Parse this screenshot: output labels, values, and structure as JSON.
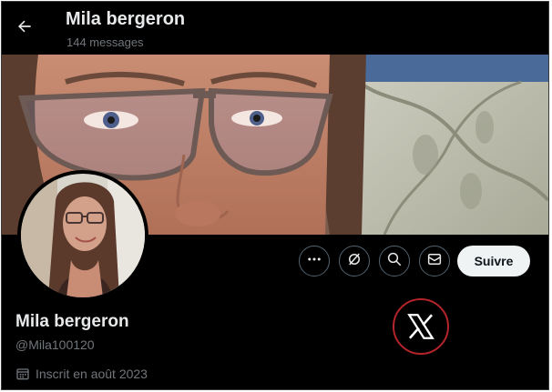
{
  "header": {
    "title": "Mila bergeron",
    "subtitle": "144 messages"
  },
  "profile": {
    "display_name": "Mila bergeron",
    "handle": "@Mila100120",
    "joined": "Inscrit en août 2023"
  },
  "actions": {
    "more": "more-icon",
    "grok": "grok-icon",
    "search": "search-icon",
    "message": "envelope-icon",
    "follow_label": "Suivre"
  },
  "colors": {
    "background": "#000000",
    "text_primary": "#e7e9ea",
    "text_secondary": "#71767b",
    "button_border": "#536471",
    "follow_bg": "#eff3f4",
    "logo_ring": "#b3242b"
  }
}
